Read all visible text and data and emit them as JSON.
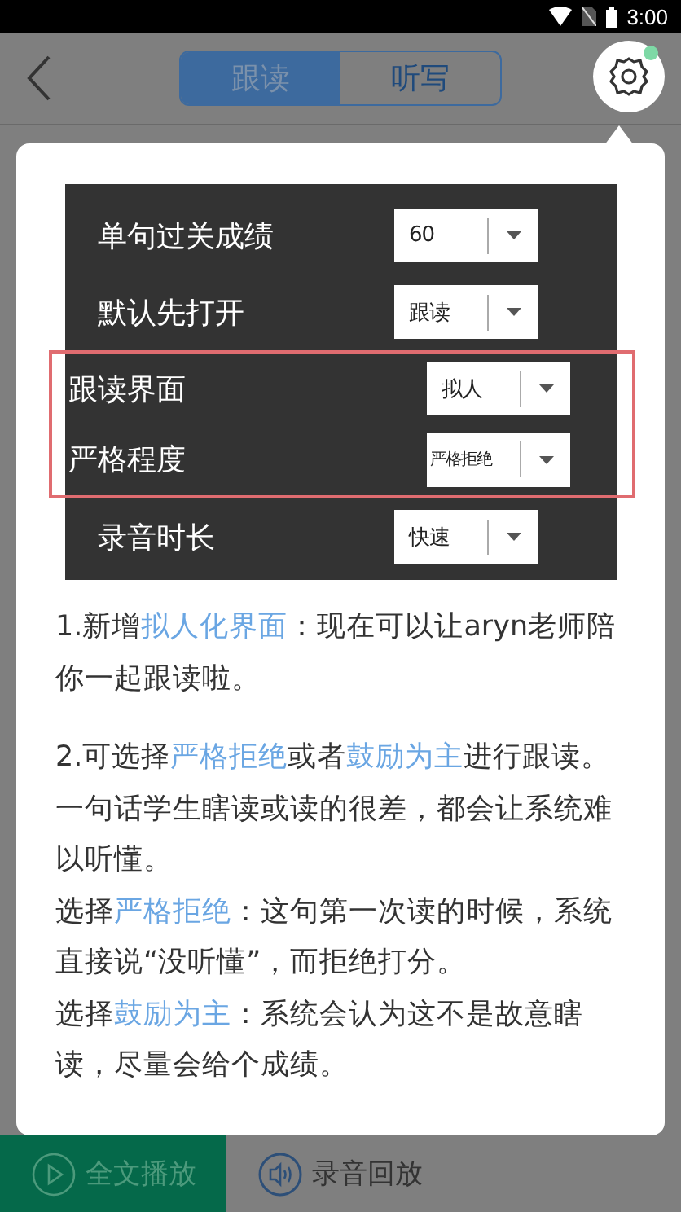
{
  "status_bar": {
    "time": "3:00"
  },
  "header": {
    "tabs": [
      {
        "label": "跟读",
        "selected": true
      },
      {
        "label": "听写",
        "selected": false
      }
    ]
  },
  "settings_popup": {
    "options": [
      {
        "label": "单句过关成绩",
        "value": "60",
        "highlighted": false
      },
      {
        "label": "默认先打开",
        "value": "跟读",
        "highlighted": false
      },
      {
        "label": "跟读界面",
        "value": "拟人",
        "highlighted": true
      },
      {
        "label": "严格程度",
        "value": "严格拒绝",
        "highlighted": true
      },
      {
        "label": "录音时长",
        "value": "快速",
        "highlighted": false
      }
    ],
    "sections": [
      {
        "paragraphs": [
          [
            {
              "text": "1.新增",
              "highlight": false
            },
            {
              "text": "拟人化界面",
              "highlight": true
            },
            {
              "text": "：现在可以让aryn老师陪你一起跟读啦。",
              "highlight": false
            }
          ]
        ]
      },
      {
        "paragraphs": [
          [
            {
              "text": "2.可选择",
              "highlight": false
            },
            {
              "text": "严格拒绝",
              "highlight": true
            },
            {
              "text": "或者",
              "highlight": false
            },
            {
              "text": "鼓励为主",
              "highlight": true
            },
            {
              "text": "进行跟读。一句话学生瞎读或读的很差，都会让系统难以听懂。",
              "highlight": false
            }
          ],
          [
            {
              "text": "选择",
              "highlight": false
            },
            {
              "text": "严格拒绝",
              "highlight": true
            },
            {
              "text": "：这句第一次读的时候，系统直接说“没听懂”，而拒绝打分。",
              "highlight": false
            }
          ],
          [
            {
              "text": "选择",
              "highlight": false
            },
            {
              "text": "鼓励为主",
              "highlight": true
            },
            {
              "text": "：系统会认为这不是故意瞎读，尽量会给个成绩。",
              "highlight": false
            }
          ]
        ]
      }
    ]
  },
  "bottom_bar": {
    "buttons": [
      {
        "label": "全文播放",
        "kind": "play",
        "selected": true
      },
      {
        "label": "录音回放",
        "kind": "playback",
        "selected": false
      }
    ]
  }
}
